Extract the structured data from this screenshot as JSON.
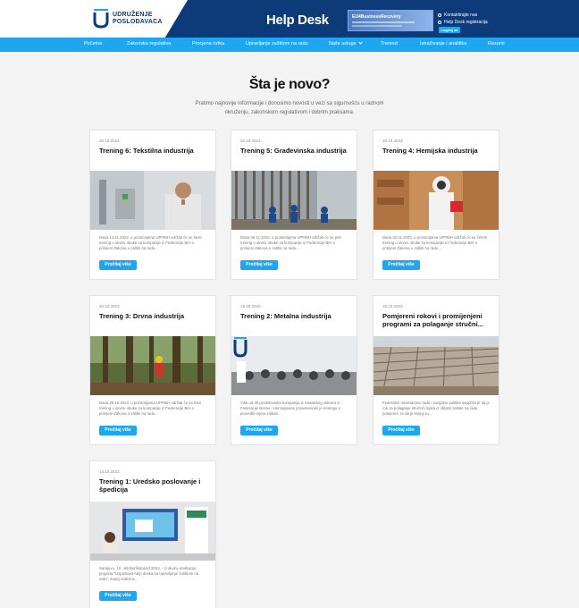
{
  "header": {
    "logo_line1": "UDRUŽENJE",
    "logo_line2": "POSLODAVACA",
    "site_title": "Help Desk",
    "promo_text": "EU4BusinessRecovery",
    "link_contact": "Kontaktirajte nas",
    "link_register": "Help Desk registracija",
    "login_label": "Logiraj se"
  },
  "nav": {
    "items": [
      "Početna",
      "Zakonska regulativa",
      "Procjena rizika",
      "Upravljanje zaštitom na radu",
      "Naše usluge",
      "Treninzi",
      "Istraživanje i analitika",
      "Resursi"
    ]
  },
  "hero": {
    "title": "Šta je novo?",
    "subtitle": "Pratimo najnovije informacije i donosimo novosti u vezi sa sigurnošću u radnom okruženju, zakonskom regulativom i dobrim praksama."
  },
  "cards": [
    {
      "date": "20.10.2023.",
      "title": "Trening 6: Tekstilna industrija",
      "excerpt": "Dana 14.11.2023. u prostorijama UPFBiH održati će se šesti trening u okviru obuke za kompanije iz Federacije BiH o primjeni Zakona o zaštiti na radu...",
      "button": "Pročitaj više"
    },
    {
      "date": "20.10.2023.",
      "title": "Trening 5: Građevinska industrija",
      "excerpt": "Dana 09.11.2023. u prostorijama UPFBiH održati će se peti trening u okviru obuke za kompanije iz Federacije BiH o primjeni Zakona o zaštiti na radu...",
      "button": "Pročitaj više"
    },
    {
      "date": "20.10.2023.",
      "title": "Trening 4: Hemijska industrija",
      "excerpt": "Dana 02.11.2023. u prostorijama UPFBiH održati će se četvrti trening u okviru obuke za kompanije iz Federacije BiH o primjeni Zakona o zaštiti na radu...",
      "button": "Pročitaj više"
    },
    {
      "date": "20.10.2023.",
      "title": "Trening 3: Drvna industrija",
      "excerpt": "Dana 26.10.2023. u prostorijama UPFBiH održati će se treći trening u okviru obuke za kompanije iz Federacije BiH o primjeni Zakona o zaštiti na radu...",
      "button": "Pročitaj više"
    },
    {
      "date": "19.10.2023.",
      "title": "Trening 2: Metalna industrija",
      "excerpt": "Više od 30 predstavnika kompanija iz metaloloig sektora iz Federacije Bosne i Hercegovine prisustvovalo je treningu o provedbi mjera zaštite...",
      "button": "Pročitaj više"
    },
    {
      "date": "16.10.2023.",
      "title": "Pomjereni rokovi i promijenjeni programi za polaganje stručni...",
      "excerpt": "Federalno ministarstvo rada i socijalne politike saopćilo je da je rok za polaganje stručnih ispita iz oblasti zaštite na radu pomjeren, te da je krajnji ro...",
      "button": "Pročitaj više"
    },
    {
      "date": "13.10.2023.",
      "title": "Trening 1: Uredsko poslovanje i špedicija",
      "excerpt": "Sarajevo, 12. oktobar/listopad 2023. - U okviru realizacije projekta \"Uspostava help deska za upravljanje zaštitom na radu\", kojeg realizira...",
      "button": "Pročitaj više"
    }
  ],
  "colors": {
    "header_bg": "#0d3a78",
    "nav_bg": "#1ea7f0",
    "button_bg": "#1ea7f0",
    "page_bg": "#f3f3f3"
  }
}
